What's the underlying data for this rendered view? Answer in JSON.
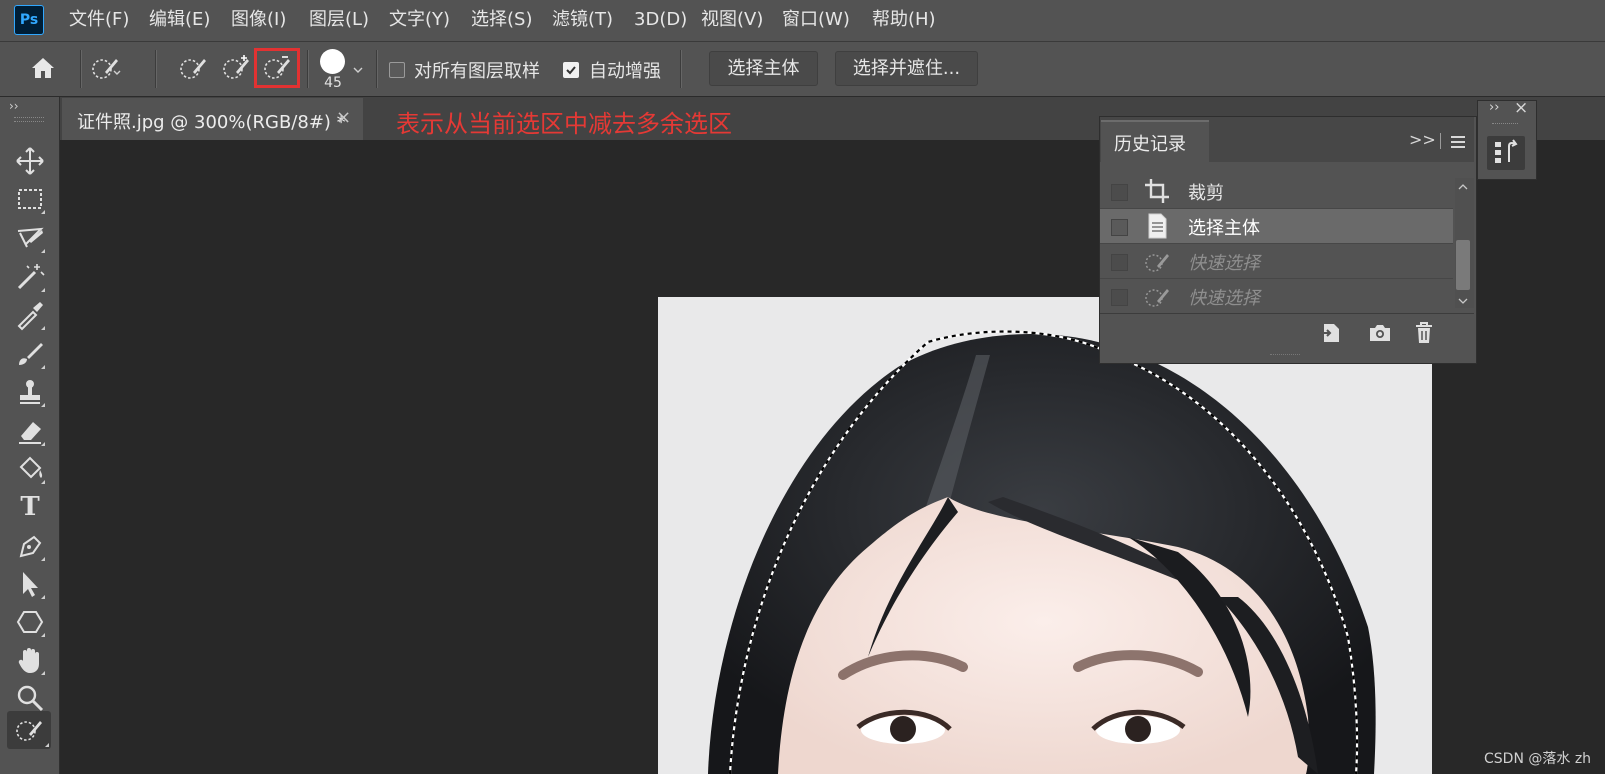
{
  "app": {
    "logo_text": "Ps",
    "accent": "#31a8ff"
  },
  "menu": [
    {
      "label": "文件(F)"
    },
    {
      "label": "编辑(E)"
    },
    {
      "label": "图像(I)"
    },
    {
      "label": "图层(L)"
    },
    {
      "label": "文字(Y)"
    },
    {
      "label": "选择(S)"
    },
    {
      "label": "滤镜(T)"
    },
    {
      "label": "3D(D)"
    },
    {
      "label": "视图(V)"
    },
    {
      "label": "窗口(W)"
    },
    {
      "label": "帮助(H)"
    }
  ],
  "options_bar": {
    "brush_size": "45",
    "sample_all_layers_label": "对所有图层取样",
    "sample_all_layers_checked": false,
    "auto_enhance_label": "自动增强",
    "auto_enhance_checked": true,
    "select_subject_label": "选择主体",
    "select_and_mask_label": "选择并遮住...",
    "active_mode": "subtract-from-selection",
    "highlight_color": "#e23232"
  },
  "document": {
    "tab_title": "证件照.jpg @ 300%(RGB/8#) *",
    "close_glyph": "×"
  },
  "annotation": {
    "text": "表示从当前选区中减去多余选区",
    "color": "#e53935"
  },
  "toolbar": {
    "tools": [
      "move-tool-icon",
      "marquee-tool-icon",
      "lasso-tool-icon",
      "magic-wand-tool-icon",
      "eyedropper-tool-icon",
      "brush-tool-icon",
      "clone-stamp-tool-icon",
      "eraser-tool-icon",
      "paint-bucket-tool-icon",
      "type-tool-icon",
      "pen-tool-icon",
      "path-selection-tool-icon",
      "shape-tool-icon",
      "hand-tool-icon",
      "zoom-tool-icon",
      "quick-selection-tool-icon"
    ],
    "type_glyph": "T"
  },
  "history_panel": {
    "title": "历史记录",
    "expand_glyph": ">>",
    "items": [
      {
        "label": "裁剪",
        "icon": "crop-icon",
        "state": "normal"
      },
      {
        "label": "选择主体",
        "icon": "document-icon",
        "state": "selected"
      },
      {
        "label": "快速选择",
        "icon": "quick-selection-icon",
        "state": "dimmed"
      },
      {
        "label": "快速选择",
        "icon": "quick-selection-icon",
        "state": "dimmed"
      }
    ]
  },
  "dock": {
    "collapse_glyph": "››",
    "close_glyph": "×"
  },
  "watermark": "CSDN @落水 zh"
}
